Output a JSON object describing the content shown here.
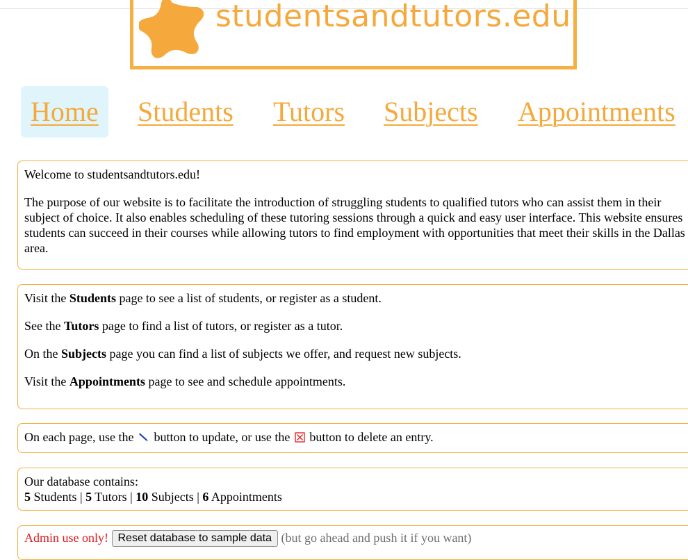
{
  "logo": {
    "text": "studentsandtutors.edu",
    "icon": "star-blob-icon",
    "color": "#f5a93c"
  },
  "nav": {
    "items": [
      {
        "label": "Home",
        "active": true
      },
      {
        "label": "Students"
      },
      {
        "label": "Tutors"
      },
      {
        "label": "Subjects"
      },
      {
        "label": "Appointments"
      }
    ],
    "active_bg": "#e0f5fb",
    "link_color": "#f5a93c"
  },
  "welcome": {
    "heading": "Welcome to studentsandtutors.edu!",
    "body": "The purpose of our website is to facilitate the introduction of struggling students to qualified tutors who can assist them in their subject of choice. It also enables scheduling of these tutoring sessions through a quick and easy user interface. This website ensures students can succeed in their courses while allowing tutors to find employment with opportunities that meet their skills in the Dallas area."
  },
  "pages_info": {
    "students": {
      "pre": "Visit the ",
      "strong": "Students",
      "post": " page to see a list of students, or register as a student."
    },
    "tutors": {
      "pre": "See the ",
      "strong": "Tutors",
      "post": " page to find a list of tutors, or register as a tutor."
    },
    "subjects": {
      "pre": "On the ",
      "strong": "Subjects",
      "post": " page you can find a list of subjects we offer, and request new subjects."
    },
    "appointments": {
      "pre": "Visit the ",
      "strong": "Appointments",
      "post": " page to see and schedule appointments."
    }
  },
  "buttons_info": {
    "pre": "On each page, use the",
    "mid": "button to update, or use the",
    "post": "button to delete an entry.",
    "update_icon": "pencil-icon",
    "delete_icon": "x-box-icon"
  },
  "database": {
    "intro": "Our database contains:",
    "students_count": "5",
    "students_label": " Students | ",
    "tutors_count": "5",
    "tutors_label": " Tutors | ",
    "subjects_count": "10",
    "subjects_label": " Subjects | ",
    "appointments_count": "6",
    "appointments_label": " Appointments"
  },
  "admin": {
    "label": "Admin use only!",
    "button": "Reset database to sample data",
    "note": "(but go ahead and push it if you want)",
    "label_color": "#e0181b"
  },
  "colors": {
    "accent": "#f5b041"
  }
}
